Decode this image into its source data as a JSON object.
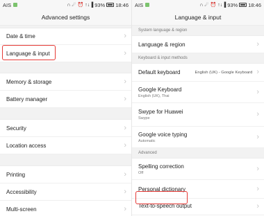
{
  "left": {
    "status": {
      "carrier": "AIS",
      "icons": "∩ ☄ ⏰",
      "signal": "↑↓▐",
      "battery": "93%",
      "time": "18:46"
    },
    "title": "Advanced settings",
    "items": [
      {
        "label": "Date & time"
      },
      {
        "label": "Language & input"
      },
      {
        "label": "Memory & storage"
      },
      {
        "label": "Battery manager"
      },
      {
        "label": "Security"
      },
      {
        "label": "Location access"
      },
      {
        "label": "Printing"
      },
      {
        "label": "Accessibility"
      },
      {
        "label": "Multi-screen"
      }
    ],
    "chevron": "›",
    "highlight_color": "#e53935"
  },
  "right": {
    "status": {
      "carrier": "AIS",
      "icons": "∩ ☄ ⏰",
      "signal": "↑↓▐",
      "battery": "93%",
      "time": "18:46"
    },
    "title": "Language & input",
    "sections": {
      "system": "System language & region",
      "keyboard": "Keyboard & input methods",
      "advanced": "Advanced"
    },
    "items": {
      "language_region": {
        "label": "Language & region"
      },
      "default_keyboard": {
        "label": "Default keyboard",
        "value": "English (UK) - Google Keyboard"
      },
      "google_keyboard": {
        "label": "Google Keyboard",
        "sub": "English (UK), Thai"
      },
      "swype": {
        "label": "Swype for Huawei",
        "sub": "Swype"
      },
      "voice": {
        "label": "Google voice typing",
        "sub": "Automatic"
      },
      "spelling": {
        "label": "Spelling correction",
        "sub": "Off"
      },
      "dictionary": {
        "label": "Personal dictionary"
      },
      "tts": {
        "label": "Text-to-speech output"
      }
    },
    "chevron": "›"
  }
}
